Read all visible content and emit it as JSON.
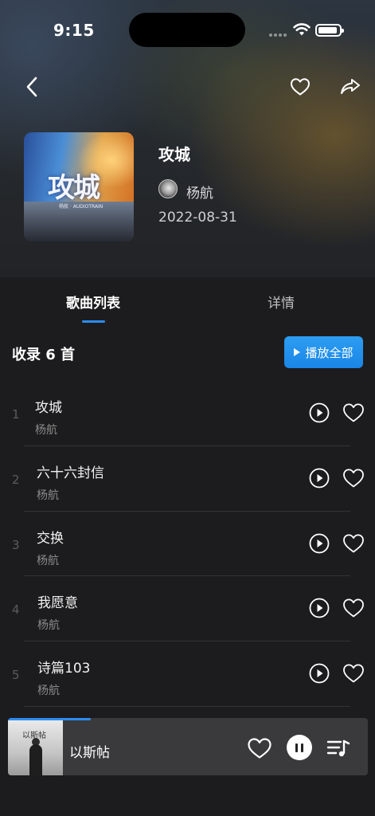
{
  "status_bar": {
    "time": "9:15"
  },
  "album": {
    "title": "攻城",
    "artist": "杨航",
    "release_date": "2022-08-31",
    "cover_text": "攻城",
    "cover_subtext": "杨航 · AUDIOTRAIN"
  },
  "tabs": [
    {
      "label": "歌曲列表",
      "active": true
    },
    {
      "label": "详情",
      "active": false
    }
  ],
  "tracklist": {
    "count_label": "收录 6 首",
    "play_all_label": "播放全部",
    "songs": [
      {
        "index": "1",
        "title": "攻城",
        "artist": "杨航"
      },
      {
        "index": "2",
        "title": "六十六封信",
        "artist": "杨航"
      },
      {
        "index": "3",
        "title": "交换",
        "artist": "杨航"
      },
      {
        "index": "4",
        "title": "我愿意",
        "artist": "杨航"
      },
      {
        "index": "5",
        "title": "诗篇103",
        "artist": "杨航"
      }
    ]
  },
  "mini_player": {
    "title": "以斯帖",
    "cover_text": "以斯帖",
    "progress": 0.23,
    "state": "playing"
  },
  "colors": {
    "accent": "#2d8cf0",
    "background": "#1c1c1e",
    "mini_player_bg": "#3a3a3c"
  },
  "icons": [
    "back-icon",
    "heart-icon",
    "share-icon",
    "play-circle-icon",
    "pause-icon",
    "playlist-icon"
  ]
}
